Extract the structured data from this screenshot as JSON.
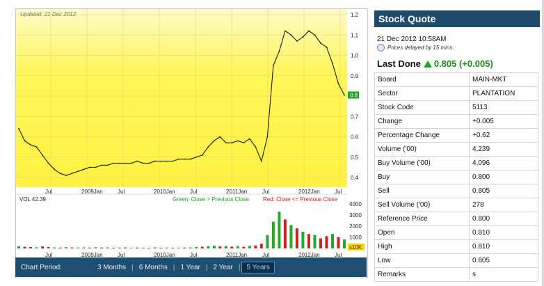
{
  "chart": {
    "updated": "Updated: 21 Dec 2012",
    "current_price_label": "0.8",
    "y_ticks": [
      "1.2",
      "1.1",
      "1.0",
      "0.9",
      "0.8",
      "0.7",
      "0.6",
      "0.5",
      "0.4"
    ],
    "x_ticks": [
      "Jul",
      "2009Jan",
      "Jul",
      "2010Jan",
      "Jul",
      "2011Jan",
      "Jul",
      "2012Jan",
      "Jul"
    ],
    "volume_label": "VOL 42.39",
    "legend_green": "Green: Close > Previous Close",
    "legend_red": "Red: Close <= Previous Close",
    "vol_ticks": [
      "4000",
      "3000",
      "2000",
      "1000"
    ],
    "vol_unit": "x10K",
    "colors": {
      "price_bg": "#fff65a",
      "up": "#28a828",
      "down": "#d02020",
      "accent": "#1d4f73"
    }
  },
  "chart_data": {
    "type": "line",
    "xlabel": "",
    "ylabel": "",
    "ylim": [
      0.4,
      1.2
    ],
    "x": [
      "2008-05",
      "2008-06",
      "2008-07",
      "2008-08",
      "2008-09",
      "2008-10",
      "2008-11",
      "2008-12",
      "2009-01",
      "2009-02",
      "2009-03",
      "2009-04",
      "2009-05",
      "2009-06",
      "2009-07",
      "2009-08",
      "2009-09",
      "2009-10",
      "2009-11",
      "2009-12",
      "2010-01",
      "2010-02",
      "2010-03",
      "2010-04",
      "2010-05",
      "2010-06",
      "2010-07",
      "2010-08",
      "2010-09",
      "2010-10",
      "2010-11",
      "2010-12",
      "2011-01",
      "2011-02",
      "2011-03",
      "2011-04",
      "2011-05",
      "2011-06",
      "2011-07",
      "2011-08",
      "2011-09",
      "2011-10",
      "2011-11",
      "2011-12",
      "2012-01",
      "2012-02",
      "2012-03",
      "2012-04",
      "2012-05",
      "2012-06",
      "2012-07",
      "2012-08",
      "2012-09",
      "2012-10",
      "2012-11",
      "2012-12"
    ],
    "series": [
      {
        "values": [
          0.64,
          0.58,
          0.56,
          0.55,
          0.51,
          0.47,
          0.44,
          0.42,
          0.41,
          0.42,
          0.43,
          0.44,
          0.45,
          0.45,
          0.46,
          0.46,
          0.47,
          0.47,
          0.47,
          0.47,
          0.48,
          0.47,
          0.47,
          0.48,
          0.48,
          0.48,
          0.48,
          0.49,
          0.49,
          0.49,
          0.5,
          0.51,
          0.55,
          0.58,
          0.6,
          0.57,
          0.57,
          0.58,
          0.57,
          0.59,
          0.55,
          0.48,
          0.6,
          0.95,
          1.02,
          1.12,
          1.1,
          1.07,
          1.09,
          1.12,
          1.1,
          1.06,
          1.04,
          0.96,
          0.86,
          0.805
        ]
      }
    ],
    "volume": {
      "ylim": [
        0,
        4000
      ],
      "values": [
        200,
        150,
        120,
        100,
        180,
        120,
        90,
        80,
        110,
        90,
        80,
        90,
        70,
        100,
        80,
        90,
        70,
        80,
        90,
        60,
        80,
        70,
        60,
        90,
        70,
        80,
        60,
        70,
        80,
        90,
        120,
        150,
        200,
        250,
        180,
        220,
        160,
        200,
        140,
        220,
        260,
        420,
        1200,
        2400,
        3300,
        2600,
        2100,
        1800,
        1500,
        1300,
        1200,
        900,
        1100,
        1300,
        1000,
        800
      ],
      "up": [
        true,
        false,
        false,
        true,
        false,
        false,
        true,
        false,
        true,
        false,
        true,
        true,
        false,
        true,
        false,
        true,
        false,
        true,
        false,
        true,
        false,
        true,
        false,
        true,
        false,
        true,
        false,
        true,
        false,
        true,
        true,
        false,
        true,
        true,
        false,
        true,
        false,
        true,
        false,
        true,
        false,
        false,
        true,
        true,
        true,
        false,
        true,
        false,
        true,
        false,
        true,
        false,
        false,
        true,
        false,
        true
      ]
    }
  },
  "periods": {
    "title": "Chart Period:",
    "items": [
      "3 Months",
      "6 Months",
      "1 Year",
      "2 Year",
      "5 Years"
    ],
    "active": "5 Years"
  },
  "quote": {
    "title": "Stock Quote",
    "timestamp": "21 Dec 2012 10:58AM",
    "delay_note": "Prices delayed by 15 mins.",
    "last_done_label": "Last Done",
    "last_done_value": "0.805 (+0.005)",
    "rows": [
      {
        "label": "Board",
        "value": "MAIN-MKT"
      },
      {
        "label": "Sector",
        "value": "PLANTATION"
      },
      {
        "label": "Stock Code",
        "value": "5113"
      },
      {
        "label": "Change",
        "value": "+0.005"
      },
      {
        "label": "Percentage Change",
        "value": "+0.62"
      },
      {
        "label": "Volume ('00)",
        "value": "4,239"
      },
      {
        "label": "Buy Volume ('00)",
        "value": "4,096"
      },
      {
        "label": "Buy",
        "value": "0.800"
      },
      {
        "label": "Sell",
        "value": "0.805"
      },
      {
        "label": "Sell Volume ('00)",
        "value": "278"
      },
      {
        "label": "Reference Price",
        "value": "0.800"
      },
      {
        "label": "Open",
        "value": "0.810"
      },
      {
        "label": "High",
        "value": "0.810"
      },
      {
        "label": "Low",
        "value": "0.805"
      },
      {
        "label": "Remarks",
        "value": "s"
      }
    ]
  }
}
